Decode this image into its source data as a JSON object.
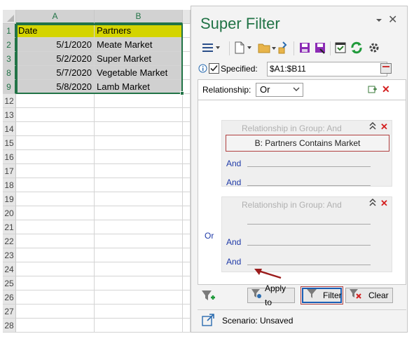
{
  "sheet": {
    "columns": [
      "A",
      "B"
    ],
    "rows": [
      {
        "num": "1",
        "a": "Date",
        "b": "Partners"
      },
      {
        "num": "2",
        "a": "5/1/2020",
        "b": "Meate Market"
      },
      {
        "num": "3",
        "a": "5/2/2020",
        "b": "Super Market"
      },
      {
        "num": "8",
        "a": "5/7/2020",
        "b": "Vegetable Market"
      },
      {
        "num": "9",
        "a": "5/8/2020",
        "b": "Lamb Market"
      },
      {
        "num": "12"
      },
      {
        "num": "13"
      },
      {
        "num": "14"
      },
      {
        "num": "15"
      },
      {
        "num": "16"
      },
      {
        "num": "17"
      },
      {
        "num": "18"
      },
      {
        "num": "19"
      },
      {
        "num": "20"
      },
      {
        "num": "21"
      },
      {
        "num": "22"
      },
      {
        "num": "23"
      },
      {
        "num": "24"
      },
      {
        "num": "25"
      },
      {
        "num": "26"
      },
      {
        "num": "27"
      },
      {
        "num": "28"
      }
    ]
  },
  "pane": {
    "title": "Super Filter",
    "specified_label": "Specified:",
    "specified_range": "$A1:$B11",
    "relationship_label": "Relationship:",
    "relationship_value": "Or",
    "group1": {
      "title": "Relationship in Group:  And",
      "condition": "B: Partners  Contains  Market",
      "and1": "And",
      "and2": "And"
    },
    "or_label": "Or",
    "group2": {
      "title": "Relationship in Group:  And",
      "and1": "And",
      "and2": "And"
    },
    "apply_to_label": "Apply to",
    "filter_label": "Filter",
    "clear_label": "Clear",
    "scenario_label": "Scenario:",
    "scenario_value": "Unsaved"
  },
  "colors": {
    "accent": "#217346",
    "header_fill": "#d4d400",
    "data_fill": "#d0d0d0",
    "link_blue": "#1f3aa8",
    "delete_red": "#d42020"
  }
}
